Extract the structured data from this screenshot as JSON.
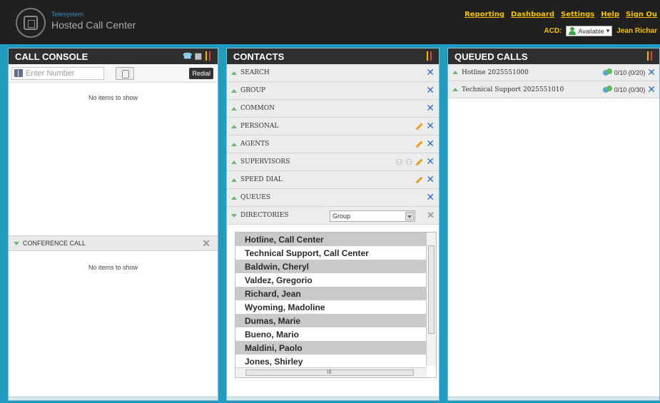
{
  "brand": {
    "small": "Telesystem",
    "big": "Hosted Call Center"
  },
  "topnav": [
    "Reporting",
    "Dashboard",
    "Settings",
    "Help",
    "Sign Ou"
  ],
  "acd": {
    "label": "ACD:",
    "status": "Available",
    "user": "Jean Richar"
  },
  "console": {
    "title": "CALL CONSOLE",
    "enter_placeholder": "Enter Number",
    "redial": "Redial",
    "empty": "No items to show",
    "conference_title": "CONFERENCE CALL",
    "conference_empty": "No items to show"
  },
  "contacts": {
    "title": "CONTACTS",
    "rows": [
      "SEARCH",
      "GROUP",
      "COMMON",
      "PERSONAL",
      "AGENTS",
      "SUPERVISORS",
      "SPEED DIAL",
      "QUEUES",
      "DIRECTORIES"
    ],
    "directory_filter": "Group",
    "directory_items": [
      "Hotline, Call Center",
      "Technical Support, Call Center",
      "Baldwin, Cheryl",
      "Valdez, Gregorio",
      "Richard, Jean",
      "Wyoming, Madoline",
      "Dumas, Marie",
      "Bueno, Mario",
      "Maldini, Paolo",
      "Jones, Shirley"
    ],
    "hscroll_label": "III"
  },
  "queued": {
    "title": "QUEUED CALLS",
    "rows": [
      {
        "name": "Hotline 2025551000",
        "stats": "0/10 (0/20)"
      },
      {
        "name": "Technical Support 2025551010",
        "stats": "0/10 (0/30)"
      }
    ]
  },
  "colors": {
    "accent": "#1f9cc0",
    "nav": "#f2c200",
    "close": "#2b6fc3"
  }
}
